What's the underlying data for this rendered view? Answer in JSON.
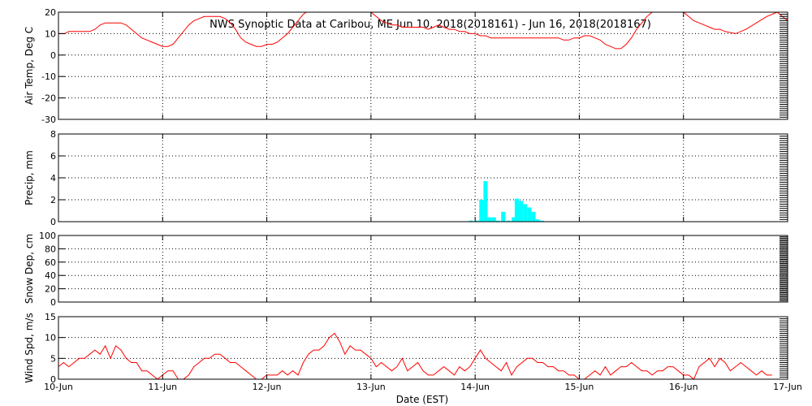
{
  "title": "NWS Synoptic Data at Caribou, ME   Jun 10, 2018(2018161) - Jun 16, 2018(2018167)",
  "x_axis_label": "Date (EST)",
  "colors": {
    "line": "#ff0000",
    "bars": "#00ffff",
    "axis": "#000000",
    "grid": "#000000"
  },
  "chart_data": [
    {
      "type": "line",
      "ylabel": "Air Temp, Deg C",
      "ylim": [
        -30,
        20
      ],
      "yticks": [
        -30,
        -20,
        -10,
        0,
        10,
        20
      ],
      "x": [
        0,
        0.03,
        0.06,
        0.1,
        0.15,
        0.2,
        0.25,
        0.3,
        0.35,
        0.4,
        0.45,
        0.5,
        0.55,
        0.6,
        0.65,
        0.7,
        0.75,
        0.8,
        0.85,
        0.9,
        0.95,
        1.0,
        1.05,
        1.1,
        1.15,
        1.2,
        1.25,
        1.3,
        1.35,
        1.4,
        1.45,
        1.5,
        1.55,
        1.6,
        1.65,
        1.7,
        1.75,
        1.8,
        1.85,
        1.9,
        1.95,
        2.0,
        2.05,
        2.1,
        2.15,
        2.2,
        2.25,
        2.3,
        2.35,
        2.38
      ],
      "y": [
        10,
        10,
        10,
        11,
        11,
        11,
        11,
        11,
        12,
        14,
        15,
        15,
        15,
        15,
        14,
        12,
        10,
        8,
        7,
        6,
        5,
        4,
        4,
        5,
        8,
        11,
        14,
        16,
        17,
        18,
        18,
        18,
        18,
        17,
        15,
        12,
        8,
        6,
        5,
        4,
        4,
        5,
        5,
        6,
        8,
        10,
        13,
        16,
        19,
        20
      ],
      "x2": [
        3.0,
        3.05,
        3.1,
        3.15,
        3.2,
        3.25,
        3.3,
        3.35,
        3.4,
        3.45,
        3.5,
        3.55,
        3.6,
        3.65,
        3.7,
        3.75,
        3.8,
        3.85,
        3.9,
        3.95,
        4.0,
        4.05,
        4.1,
        4.15,
        4.2,
        4.25,
        4.3,
        4.35,
        4.4,
        4.45,
        4.5,
        4.55,
        4.6,
        4.65,
        4.7,
        4.75,
        4.8,
        4.85,
        4.9,
        4.95,
        5.0,
        5.05,
        5.1,
        5.15,
        5.2,
        5.25,
        5.3,
        5.35,
        5.4
      ],
      "y2": [
        20,
        18,
        16,
        15,
        14,
        14,
        13,
        13,
        13,
        13,
        13,
        12,
        13,
        14,
        13,
        12,
        12,
        11,
        11,
        10,
        10,
        9,
        9,
        8,
        8,
        8,
        8,
        8,
        8,
        8,
        8,
        8,
        8,
        8,
        8,
        8,
        8,
        7,
        7,
        8,
        8,
        9,
        9,
        8,
        7,
        5,
        4,
        3,
        3
      ],
      "x3": [
        5.4,
        5.45,
        5.5,
        5.55,
        5.6,
        5.65,
        5.7,
        5.75,
        5.8,
        5.85,
        5.9,
        5.95,
        6.0,
        6.05,
        6.1,
        6.15,
        6.2,
        6.25,
        6.3,
        6.35,
        6.4,
        6.5,
        6.6,
        6.7,
        6.8,
        6.9,
        6.95,
        7.0
      ],
      "y3": [
        3,
        5,
        8,
        12,
        15,
        18,
        20,
        20,
        20,
        20,
        20,
        20,
        20,
        18,
        16,
        15,
        14,
        13,
        12,
        12,
        11,
        10,
        12,
        15,
        18,
        20,
        18,
        16
      ]
    },
    {
      "type": "bar",
      "ylabel": "Precip, mm",
      "ylim": [
        0,
        8
      ],
      "yticks": [
        0,
        2,
        4,
        6,
        8
      ],
      "x": [
        3.94,
        4.0,
        4.04,
        4.08,
        4.12,
        4.16,
        4.2,
        4.25,
        4.3,
        4.35,
        4.38,
        4.42,
        4.46,
        4.5,
        4.54,
        4.58,
        4.62
      ],
      "values": [
        0.1,
        0.1,
        2.0,
        3.7,
        0.4,
        0.4,
        0.1,
        0.9,
        0.1,
        0.4,
        2.1,
        1.9,
        1.6,
        1.3,
        0.9,
        0.2,
        0.1
      ]
    },
    {
      "type": "line",
      "ylabel": "Snow Dep, cm",
      "ylim": [
        0,
        100
      ],
      "yticks": [
        0,
        20,
        40,
        60,
        80,
        100
      ],
      "x": [],
      "y": []
    },
    {
      "type": "line",
      "ylabel": "Wind Spd, m/s",
      "ylim": [
        0,
        15
      ],
      "yticks": [
        0,
        5,
        10,
        15
      ],
      "x": [
        0,
        0.05,
        0.1,
        0.15,
        0.2,
        0.25,
        0.3,
        0.35,
        0.4,
        0.45,
        0.5,
        0.55,
        0.6,
        0.65,
        0.7,
        0.75,
        0.8,
        0.85,
        0.9,
        0.95,
        1.0,
        1.05,
        1.1,
        1.15,
        1.2,
        1.25,
        1.3,
        1.35,
        1.4,
        1.45,
        1.5,
        1.55,
        1.6,
        1.65,
        1.7,
        1.75,
        1.8,
        1.85,
        1.9,
        1.95,
        2.0,
        2.05,
        2.1,
        2.15,
        2.2,
        2.25,
        2.3,
        2.35,
        2.4,
        2.45,
        2.5,
        2.55,
        2.6,
        2.65,
        2.7,
        2.75,
        2.8,
        2.85,
        2.9,
        2.95,
        3.0,
        3.05,
        3.1,
        3.15,
        3.2,
        3.25,
        3.3,
        3.35,
        3.4,
        3.45,
        3.5,
        3.55,
        3.6,
        3.65,
        3.7,
        3.75,
        3.8,
        3.85,
        3.9,
        3.95,
        4.0,
        4.05,
        4.1,
        4.15,
        4.2,
        4.25,
        4.3,
        4.35,
        4.4,
        4.45,
        4.5,
        4.55,
        4.6,
        4.65,
        4.7,
        4.75,
        4.8,
        4.85,
        4.9,
        4.95,
        5.0,
        5.05,
        5.1,
        5.15,
        5.2,
        5.25,
        5.3,
        5.35,
        5.4,
        5.45,
        5.5,
        5.55,
        5.6,
        5.65,
        5.7,
        5.75,
        5.8,
        5.85,
        5.9,
        5.95,
        6.0,
        6.05,
        6.1,
        6.15,
        6.2,
        6.25,
        6.3,
        6.35,
        6.4,
        6.45,
        6.5,
        6.55,
        6.6,
        6.65,
        6.7,
        6.75,
        6.8,
        6.85,
        6.9,
        6.95,
        7.0
      ],
      "y": [
        3,
        4,
        3,
        4,
        5,
        5,
        6,
        7,
        6,
        8,
        5,
        8,
        7,
        5,
        4,
        4,
        2,
        2,
        1,
        0,
        1,
        2,
        2,
        0,
        0,
        1,
        3,
        4,
        5,
        5,
        6,
        6,
        5,
        4,
        4,
        3,
        2,
        1,
        0,
        0,
        1,
        1,
        1,
        2,
        1,
        2,
        1,
        4,
        6,
        7,
        7,
        8,
        10,
        11,
        9,
        6,
        8,
        7,
        7,
        6,
        5,
        3,
        4,
        3,
        2,
        3,
        5,
        2,
        3,
        4,
        2,
        1,
        1,
        2,
        3,
        2,
        1,
        3,
        2,
        3,
        5,
        7,
        5,
        4,
        3,
        2,
        4,
        1,
        3,
        4,
        5,
        5,
        4,
        4,
        3,
        3,
        2,
        2,
        1,
        1,
        0,
        0,
        1,
        2,
        1,
        3,
        1,
        2,
        3,
        3,
        4,
        3,
        2,
        2,
        1,
        2,
        2,
        3,
        3,
        2,
        1,
        1,
        0,
        3,
        4,
        5,
        3,
        5,
        4,
        2,
        3,
        4,
        3,
        2,
        1,
        2,
        1,
        1
      ]
    }
  ],
  "x_ticks": [
    "10-Jun",
    "11-Jun",
    "12-Jun",
    "13-Jun",
    "14-Jun",
    "15-Jun",
    "16-Jun",
    "17-Jun"
  ]
}
